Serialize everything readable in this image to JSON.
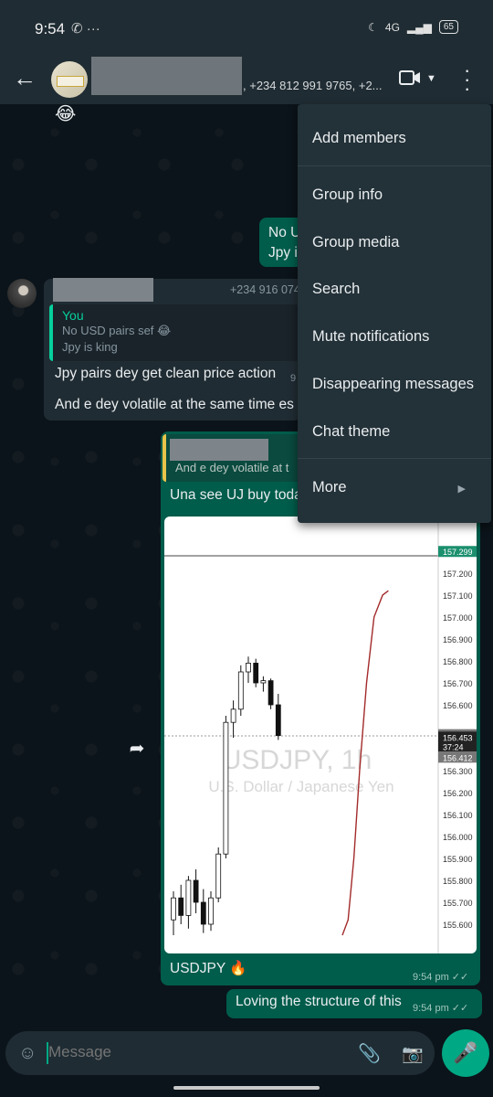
{
  "status_bar": {
    "time": "9:54",
    "left_icons": "✆  ···",
    "network": "4G",
    "battery": "65"
  },
  "header": {
    "members": ", +234 812 991 9765, +2..."
  },
  "menu": {
    "items": [
      "Add members",
      "Group info",
      "Group media",
      "Search",
      "Mute notifications",
      "Disappearing messages",
      "Chat theme",
      "More"
    ]
  },
  "messages": {
    "first_emoji": "😂",
    "out1": "No U\nJpy i",
    "in_sender_phone": "+234 916 074",
    "quote_author": "You",
    "quote_line1": "No USD pairs sef 😂",
    "quote_line2": "Jpy is king",
    "in_text": "Jpy pairs dey get clean price action",
    "in_time": "9",
    "in_text2": "And e dey volatile at the same time es",
    "reply_preview": "And e dey volatile at t",
    "reply_text": "Una see UJ buy toda",
    "caption": "USDJPY 🔥",
    "caption_time": "9:54 pm ✓✓",
    "last_text": "Loving the structure of this",
    "last_time": "9:54 pm ✓✓"
  },
  "input": {
    "placeholder": "Message"
  },
  "colors": {
    "accent": "#00a884",
    "outgoing": "#005c4b",
    "incoming": "#202c33",
    "bg": "#0b141a"
  },
  "chart_data": {
    "type": "candlestick",
    "title": "USDJPY, 1h",
    "subtitle": "U.S. Dollar / Japanese Yen",
    "y_ticks": [
      "157.299",
      "157.200",
      "157.100",
      "157.000",
      "156.900",
      "156.800",
      "156.700",
      "156.600",
      "156.464",
      "156.453",
      "37:24",
      "156.412",
      "156.300",
      "156.200",
      "156.100",
      "156.000",
      "155.900",
      "155.800",
      "155.700",
      "155.600"
    ],
    "ylim": [
      155.55,
      157.35
    ],
    "candles": [
      {
        "o": 155.62,
        "h": 155.75,
        "l": 155.55,
        "c": 155.72
      },
      {
        "o": 155.72,
        "h": 155.78,
        "l": 155.6,
        "c": 155.64
      },
      {
        "o": 155.64,
        "h": 155.82,
        "l": 155.58,
        "c": 155.8
      },
      {
        "o": 155.8,
        "h": 155.85,
        "l": 155.65,
        "c": 155.7
      },
      {
        "o": 155.7,
        "h": 155.76,
        "l": 155.56,
        "c": 155.6
      },
      {
        "o": 155.6,
        "h": 155.75,
        "l": 155.57,
        "c": 155.72
      },
      {
        "o": 155.72,
        "h": 155.95,
        "l": 155.7,
        "c": 155.92
      },
      {
        "o": 155.92,
        "h": 156.55,
        "l": 155.9,
        "c": 156.52
      },
      {
        "o": 156.52,
        "h": 156.62,
        "l": 156.45,
        "c": 156.58
      },
      {
        "o": 156.58,
        "h": 156.78,
        "l": 156.55,
        "c": 156.75
      },
      {
        "o": 156.75,
        "h": 156.82,
        "l": 156.7,
        "c": 156.79
      },
      {
        "o": 156.79,
        "h": 156.81,
        "l": 156.68,
        "c": 156.7
      },
      {
        "o": 156.7,
        "h": 156.73,
        "l": 156.66,
        "c": 156.71
      },
      {
        "o": 156.71,
        "h": 156.72,
        "l": 156.58,
        "c": 156.6
      },
      {
        "o": 156.6,
        "h": 156.65,
        "l": 156.44,
        "c": 156.46
      }
    ],
    "current_price": "156.453",
    "high_marker": "157.299",
    "indicator_line": [
      [
        0.0,
        155.55
      ],
      [
        0.1,
        155.62
      ],
      [
        0.2,
        155.9
      ],
      [
        0.3,
        156.3
      ],
      [
        0.42,
        156.7
      ],
      [
        0.55,
        157.0
      ],
      [
        0.7,
        157.1
      ],
      [
        0.8,
        157.12
      ]
    ]
  }
}
